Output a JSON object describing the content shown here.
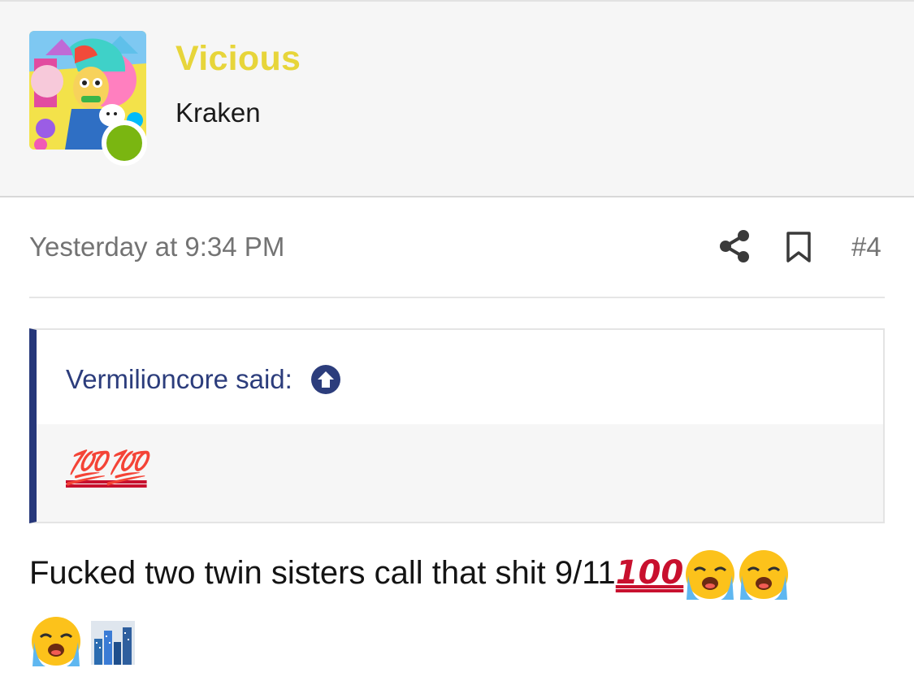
{
  "post": {
    "username": "Vicious",
    "user_title": "Kraken",
    "date": "Yesterday at 9:34 PM",
    "post_number": "#4",
    "online": true
  },
  "quote": {
    "author_line": "Vermilioncore said:",
    "body": "💯💯"
  },
  "message": {
    "text": "Fucked two twin sisters call that shit 9/11",
    "trailing_emojis": [
      "hundred-points-emoji",
      "loudly-crying-face-emoji",
      "loudly-crying-face-emoji",
      "loudly-crying-face-emoji",
      "cityscape-emoji"
    ]
  },
  "colors": {
    "username": "#e7d53a",
    "quote_accent": "#26377a",
    "online": "#7ab611",
    "hundred": "#c8102e"
  },
  "icons": {
    "share": "share-icon",
    "bookmark": "bookmark-icon",
    "quote_jump": "arrow-up-circle-icon"
  }
}
